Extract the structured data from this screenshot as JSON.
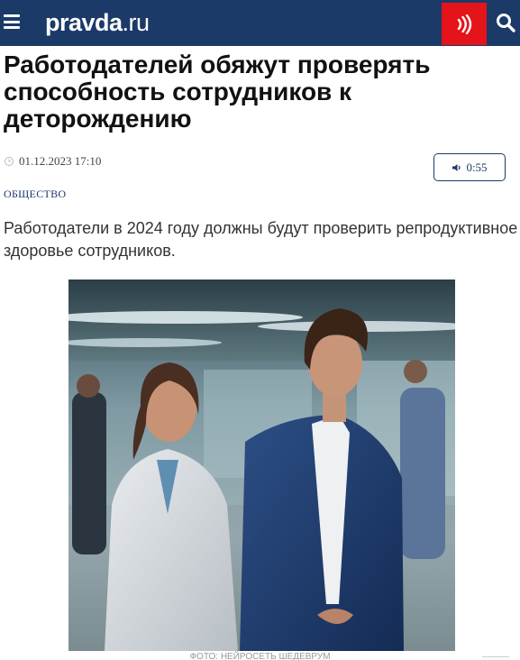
{
  "header": {
    "logo_main": "pravda",
    "logo_tld": ".ru",
    "menu_icon": "hamburger-icon",
    "radio_icon": "radio-waves-icon",
    "search_icon": "search-icon",
    "bar_color": "#1b3a68",
    "radio_color": "#e4141a"
  },
  "article": {
    "headline": "Работодателей обяжут проверять способность сотрудников к деторождению",
    "datetime": "01.12.2023 17:10",
    "audio_duration": "0:55",
    "rubric": "ОБЩЕСТВО",
    "lead": "Работодатели в 2024 году должны будут проверить репродуктивное здоровье сотрудников.",
    "photo_caption": "ФОТО: НЕЙРОСЕТЬ ШЕДЕВРУМ"
  }
}
